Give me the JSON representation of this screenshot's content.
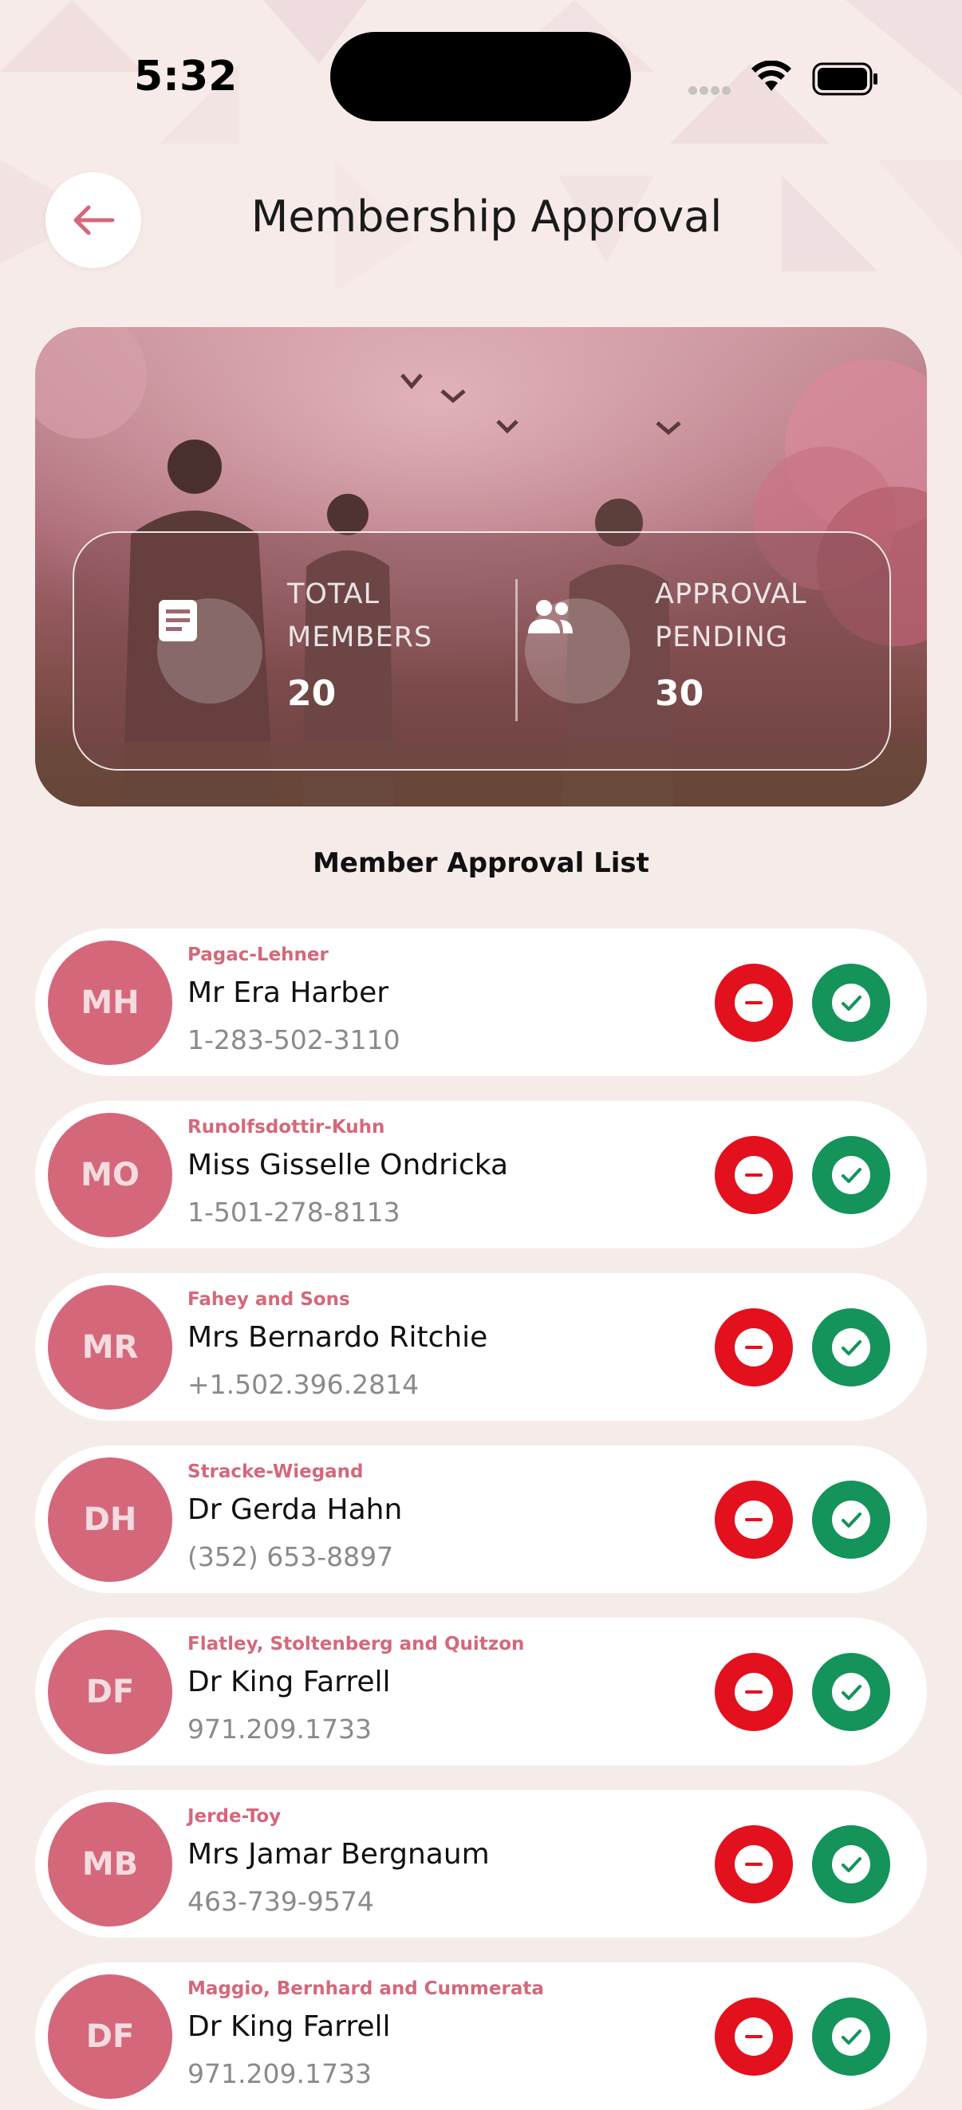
{
  "status_bar": {
    "time": "5:32"
  },
  "header": {
    "title": "Membership Approval"
  },
  "stats": [
    {
      "label_line1": "TOTAL",
      "label_line2": "MEMBERS",
      "value": "20",
      "icon": "document-icon"
    },
    {
      "label_line1": "APPROVAL",
      "label_line2": "PENDING",
      "value": "30",
      "icon": "people-icon"
    }
  ],
  "list_title": "Member Approval List",
  "members": [
    {
      "initials": "MH",
      "company": "Pagac-Lehner",
      "name": "Mr Era Harber",
      "phone": "1-283-502-3110"
    },
    {
      "initials": "MO",
      "company": "Runolfsdottir-Kuhn",
      "name": "Miss Gisselle Ondricka",
      "phone": "1-501-278-8113"
    },
    {
      "initials": "MR",
      "company": "Fahey and Sons",
      "name": "Mrs Bernardo Ritchie",
      "phone": "+1.502.396.2814"
    },
    {
      "initials": "DH",
      "company": "Stracke-Wiegand",
      "name": "Dr Gerda Hahn",
      "phone": "(352) 653-8897"
    },
    {
      "initials": "DF",
      "company": "Flatley, Stoltenberg and Quitzon",
      "name": "Dr King Farrell",
      "phone": "971.209.1733"
    },
    {
      "initials": "MB",
      "company": "Jerde-Toy",
      "name": "Mrs Jamar Bergnaum",
      "phone": "463-739-9574"
    },
    {
      "initials": "DF",
      "company": "Maggio, Bernhard and Cummerata",
      "name": "Dr King Farrell",
      "phone": "971.209.1733"
    }
  ],
  "colors": {
    "accent": "#d4687a",
    "reject": "#e3101e",
    "approve": "#14935a",
    "background": "#f5ecea"
  }
}
